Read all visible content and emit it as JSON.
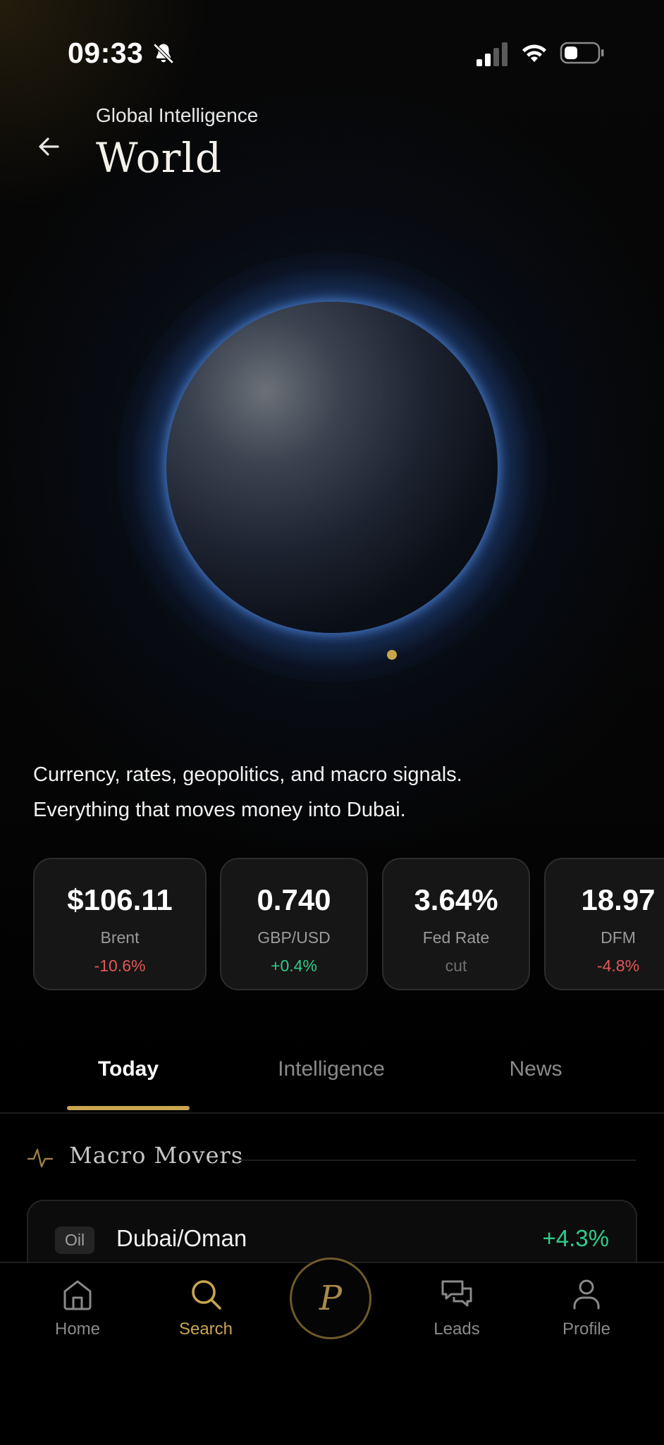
{
  "status_bar": {
    "time": "09:33",
    "icons": [
      "bell-slash-icon",
      "signal-icon",
      "wifi-icon",
      "battery-icon"
    ]
  },
  "header": {
    "eyebrow": "Global Intelligence",
    "title": "World",
    "back_icon": "arrow-left-icon"
  },
  "hero": {
    "description_line1": "Currency, rates, geopolitics, and macro signals.",
    "description_line2": "Everything that moves money into Dubai."
  },
  "stats": [
    {
      "value": "$106.11",
      "label": "Brent",
      "change": "-10.6%",
      "trend": "negative"
    },
    {
      "value": "0.740",
      "label": "GBP/USD",
      "change": "+0.4%",
      "trend": "positive"
    },
    {
      "value": "3.64%",
      "label": "Fed Rate",
      "change": "cut",
      "trend": "neutral"
    },
    {
      "value": "18.97",
      "label": "DFM",
      "change": "-4.8%",
      "trend": "negative"
    }
  ],
  "tabs": [
    {
      "label": "Today",
      "active": true
    },
    {
      "label": "Intelligence",
      "active": false
    },
    {
      "label": "News",
      "active": false
    }
  ],
  "section": {
    "icon": "pulse-icon",
    "title": "Macro Movers"
  },
  "movers": [
    {
      "tag": "Oil",
      "name": "Dubai/Oman",
      "change": "+4.3%"
    }
  ],
  "bottom_nav": {
    "items": [
      {
        "label": "Home",
        "icon": "home-icon",
        "active": false
      },
      {
        "label": "Search",
        "icon": "search-icon",
        "active": true
      },
      {
        "label": "Leads",
        "icon": "chat-bubbles-icon",
        "active": false
      },
      {
        "label": "Profile",
        "icon": "person-icon",
        "active": false
      }
    ],
    "center_button": "P"
  },
  "colors": {
    "accent_gold": "#c9a550",
    "positive": "#2ecc8a",
    "negative": "#e25757",
    "globe_glow": "#5a96f0"
  }
}
